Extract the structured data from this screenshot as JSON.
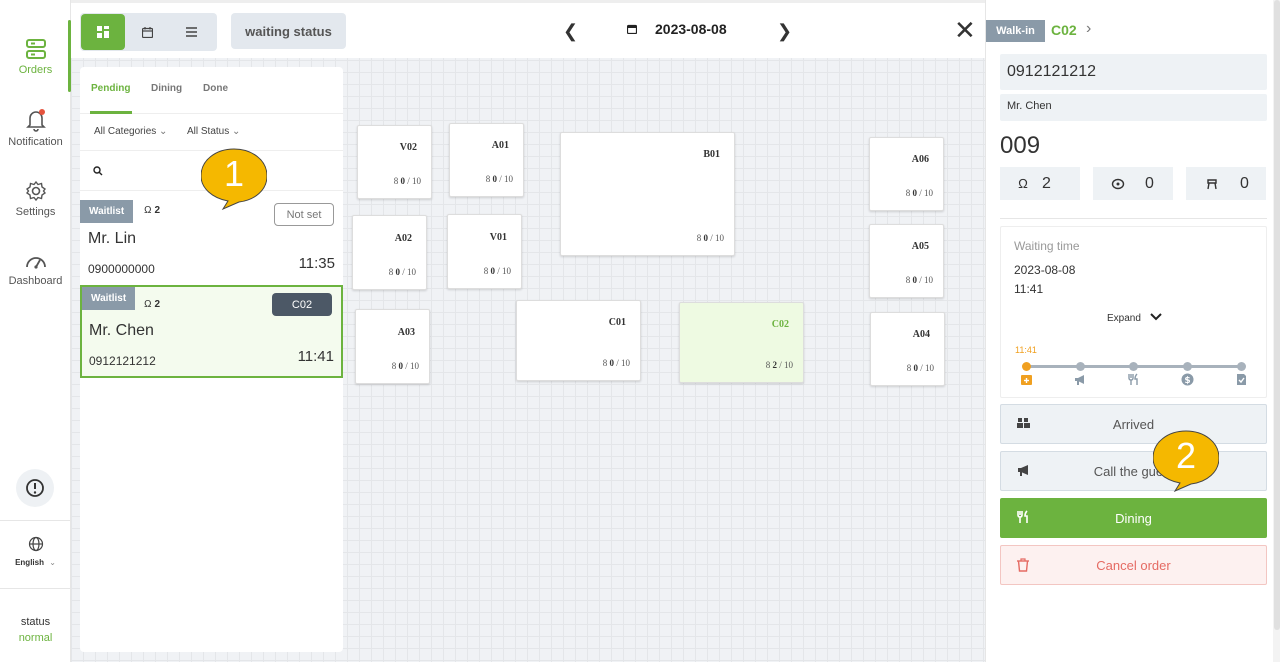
{
  "nav": {
    "orders": "Orders",
    "notification": "Notification",
    "settings": "Settings",
    "dashboard": "Dashboard",
    "language": "English",
    "status_label": "status",
    "status_value": "normal"
  },
  "topbar": {
    "waiting_status": "waiting status",
    "date": "2023-08-08"
  },
  "list": {
    "tabs": [
      "Pending",
      "Dining",
      "Done"
    ],
    "filter_category": "All Categories",
    "filter_status": "All Status",
    "orders": [
      {
        "badge": "Waitlist",
        "people": "2",
        "tag": "Not set",
        "name": "Mr. Lin",
        "phone": "0900000000",
        "time": "11:35"
      },
      {
        "badge": "Waitlist",
        "people": "2",
        "tag": "C02",
        "name": "Mr. Chen",
        "phone": "0912121212",
        "time": "11:41"
      }
    ]
  },
  "callouts": {
    "one": "1",
    "two": "2"
  },
  "tables": [
    {
      "name": "V02",
      "seated": "0",
      "cap": "/ 10"
    },
    {
      "name": "A01",
      "seated": "0",
      "cap": "/ 10"
    },
    {
      "name": "B01",
      "seated": "0",
      "cap": "/ 10"
    },
    {
      "name": "A06",
      "seated": "0",
      "cap": "/ 10"
    },
    {
      "name": "A02",
      "seated": "0",
      "cap": "/ 10"
    },
    {
      "name": "V01",
      "seated": "0",
      "cap": "/ 10"
    },
    {
      "name": "A05",
      "seated": "0",
      "cap": "/ 10"
    },
    {
      "name": "A03",
      "seated": "0",
      "cap": "/ 10"
    },
    {
      "name": "C01",
      "seated": "0",
      "cap": "/ 10"
    },
    {
      "name": "C02",
      "seated": "2",
      "cap": "/ 10"
    },
    {
      "name": "A04",
      "seated": "0",
      "cap": "/ 10"
    }
  ],
  "detail": {
    "type": "Walk-in",
    "table": "C02",
    "phone": "0912121212",
    "name": "Mr. Chen",
    "order_no": "009",
    "adults": "2",
    "children": "0",
    "chairs": "0",
    "waiting_label": "Waiting time",
    "waiting_date": "2023-08-08",
    "waiting_time": "11:41",
    "expand": "Expand",
    "timeline_time": "11:41",
    "btn_arrived": "Arrived",
    "btn_call": "Call the guest",
    "btn_dining": "Dining",
    "btn_cancel": "Cancel order"
  },
  "colors": {
    "accent": "#6cb33f",
    "badge": "#8a9aa8",
    "danger": "#e56b63",
    "callout": "#f5b800"
  }
}
